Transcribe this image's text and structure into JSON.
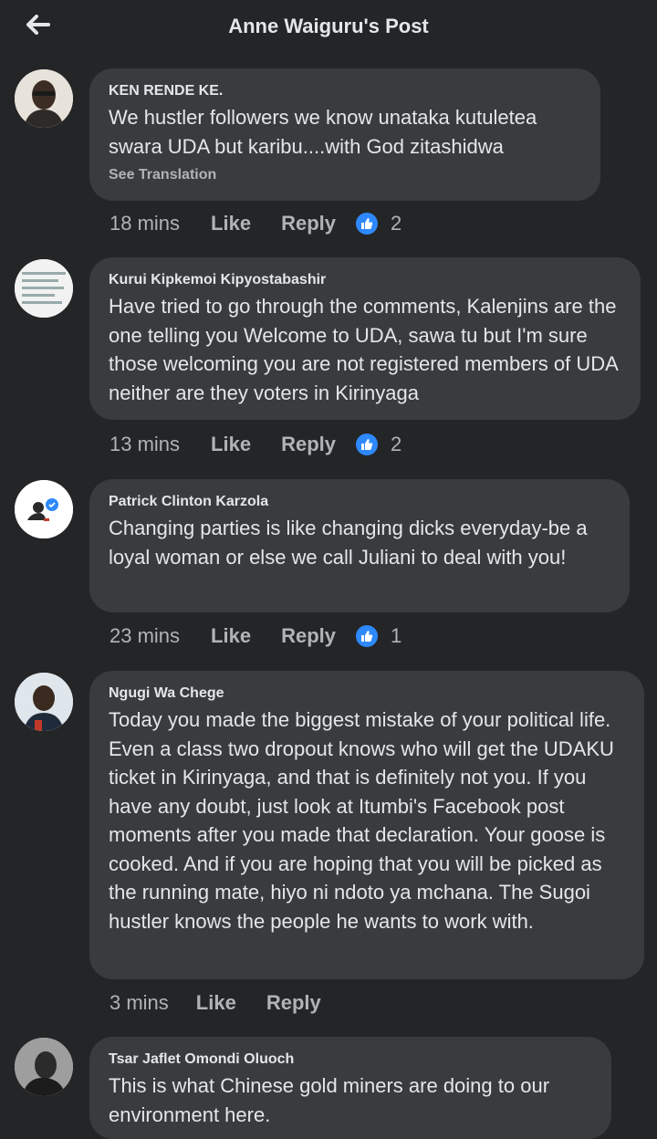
{
  "header": {
    "title": "Anne Waiguru's Post"
  },
  "comments": [
    {
      "author": "KEN RENDE KE.",
      "text": "We hustler followers we know unataka kutuletea swara UDA but karibu....with God zitashidwa",
      "see_translation": "See Translation",
      "time": "18 mins",
      "like_label": "Like",
      "reply_label": "Reply",
      "reactions": "2"
    },
    {
      "author": "Kurui Kipkemoi Kipyostabashir",
      "text": "Have tried to go through the comments, Kalenjins are the one telling you Welcome to UDA, sawa tu but I'm sure those welcoming you are not registered members of UDA neither are they voters in Kirinyaga",
      "time": "13 mins",
      "like_label": "Like",
      "reply_label": "Reply",
      "reactions": "2"
    },
    {
      "author": "Patrick Clinton Karzola",
      "text": "Changing parties is like changing dicks everyday-be a loyal woman or else we call Juliani to deal with you!",
      "time": "23 mins",
      "like_label": "Like",
      "reply_label": "Reply",
      "reactions": "1"
    },
    {
      "author": "Ngugi Wa Chege",
      "text": "Today you made the biggest mistake of your political life. Even a class two dropout knows who will get the UDAKU ticket in Kirinyaga, and that is definitely not you. If you have any doubt, just look at Itumbi's Facebook post moments after you made that declaration. Your goose is cooked. And if you are hoping that you will be picked as the running mate, hiyo ni ndoto ya mchana. The Sugoi hustler knows the people he wants to work with.",
      "time": "3 mins",
      "like_label": "Like",
      "reply_label": "Reply"
    },
    {
      "author": "Tsar Jaflet Omondi Oluoch",
      "text": "This is what Chinese gold miners are doing to our environment here."
    }
  ],
  "icons": {
    "back": "arrow-left-icon",
    "reaction": "thumbs-up-icon",
    "verified": "verified-badge-icon"
  },
  "colors": {
    "background": "#242526",
    "bubble": "#3a3b3c",
    "text": "#e4e6eb",
    "secondary_text": "#b0b3b8",
    "like_blue": "#2e89ff"
  }
}
